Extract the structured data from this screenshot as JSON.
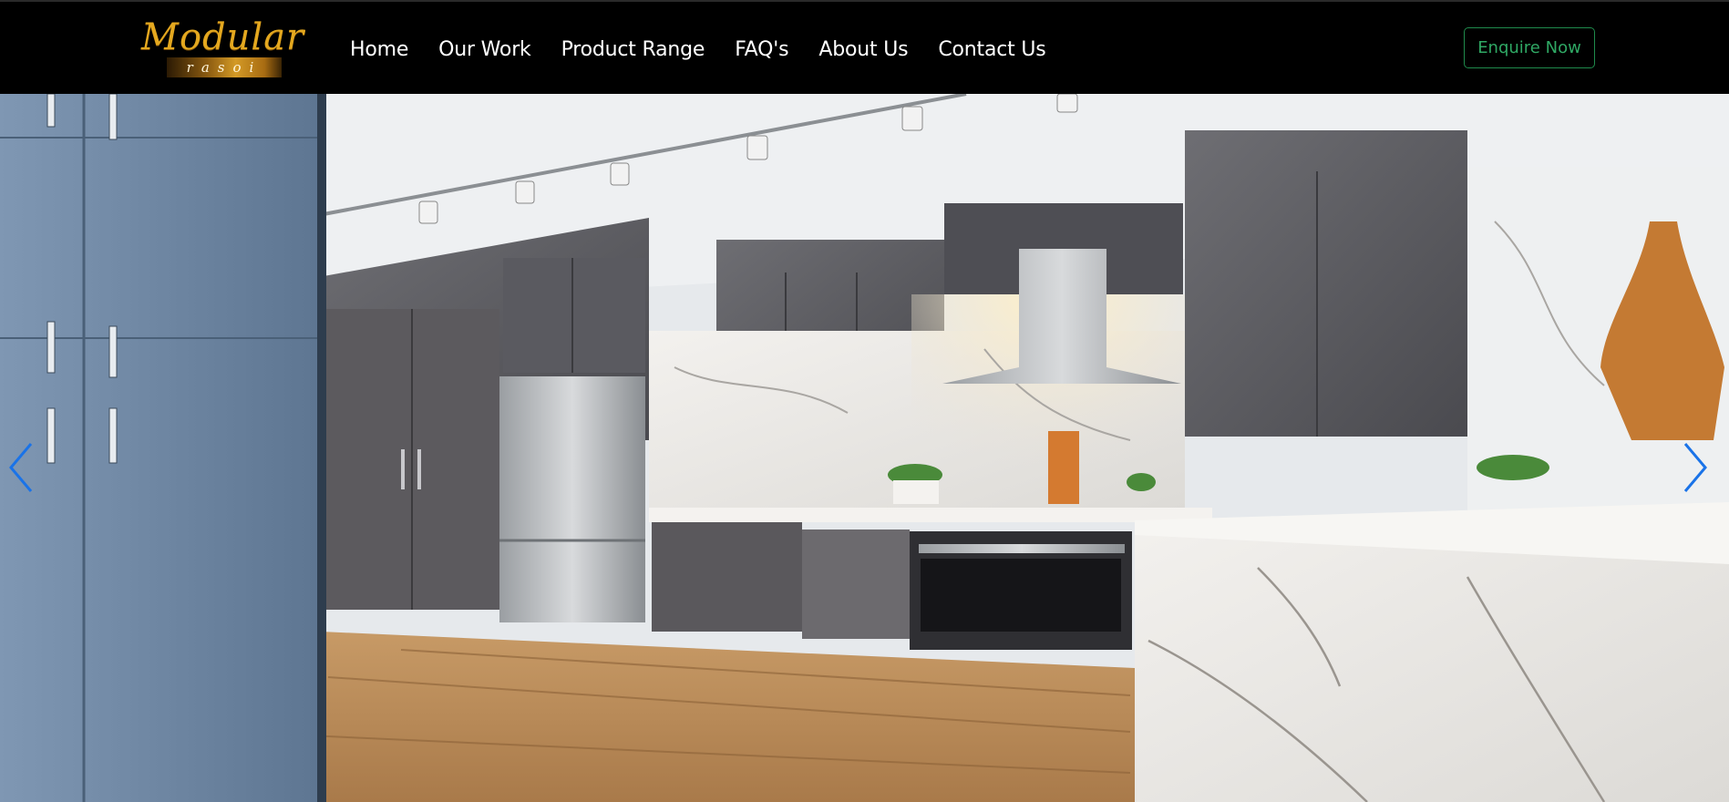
{
  "brand": {
    "name": "Modular",
    "sub": "rasoi"
  },
  "nav": {
    "items": [
      {
        "label": "Home"
      },
      {
        "label": "Our Work"
      },
      {
        "label": "Product Range"
      },
      {
        "label": "FAQ's"
      },
      {
        "label": "About Us"
      },
      {
        "label": "Contact Us"
      }
    ]
  },
  "cta": {
    "label": "Enquire Now"
  },
  "slider": {
    "prev_icon": "chevron-left-icon",
    "next_icon": "chevron-right-icon"
  },
  "colors": {
    "navbar_bg": "#000000",
    "logo_gold": "#e4a81f",
    "cta_green": "#2fa864",
    "arrow_blue": "#1a73e8"
  }
}
